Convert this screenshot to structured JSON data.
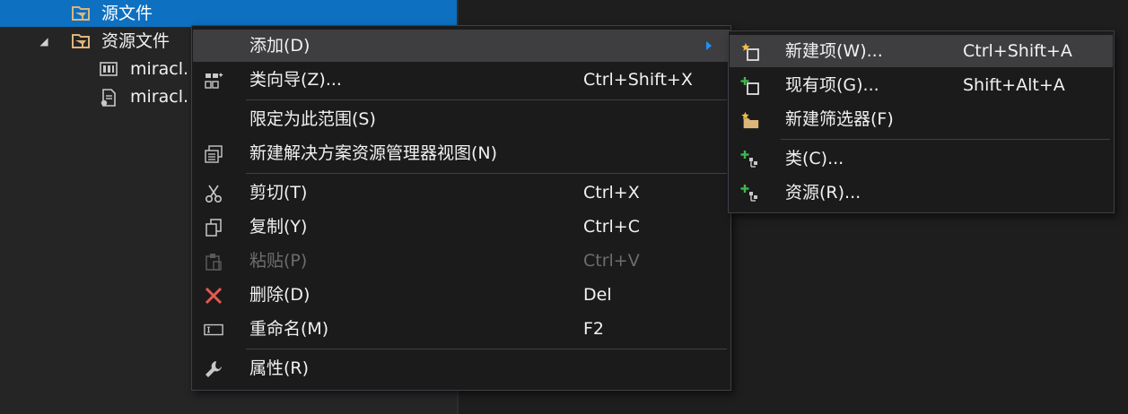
{
  "tree": {
    "items": [
      {
        "label": "源文件",
        "selected": true
      },
      {
        "label": "资源文件",
        "expanded": true
      },
      {
        "label": "miracl."
      },
      {
        "label": "miracl."
      }
    ]
  },
  "context_menu": {
    "items": [
      {
        "label": "添加(D)",
        "shortcut": "",
        "has_submenu": true
      },
      {
        "label": "类向导(Z)...",
        "shortcut": "Ctrl+Shift+X"
      },
      {
        "label": "限定为此范围(S)",
        "shortcut": ""
      },
      {
        "label": "新建解决方案资源管理器视图(N)",
        "shortcut": ""
      },
      {
        "label": "剪切(T)",
        "shortcut": "Ctrl+X"
      },
      {
        "label": "复制(Y)",
        "shortcut": "Ctrl+C"
      },
      {
        "label": "粘贴(P)",
        "shortcut": "Ctrl+V",
        "disabled": true
      },
      {
        "label": "删除(D)",
        "shortcut": "Del"
      },
      {
        "label": "重命名(M)",
        "shortcut": "F2"
      },
      {
        "label": "属性(R)",
        "shortcut": ""
      }
    ]
  },
  "submenu": {
    "items": [
      {
        "label": "新建项(W)...",
        "shortcut": "Ctrl+Shift+A"
      },
      {
        "label": "现有项(G)...",
        "shortcut": "Shift+Alt+A"
      },
      {
        "label": "新建筛选器(F)",
        "shortcut": ""
      },
      {
        "label": "类(C)...",
        "shortcut": ""
      },
      {
        "label": "资源(R)...",
        "shortcut": ""
      }
    ]
  },
  "colors": {
    "selection": "#0e70c0",
    "menu_background": "#1b1b1c",
    "hover": "#3e3e40",
    "delete_icon": "#e8594e",
    "add_plus": "#3cb94a",
    "star": "#f0c040",
    "folder": "#dcb67a"
  }
}
